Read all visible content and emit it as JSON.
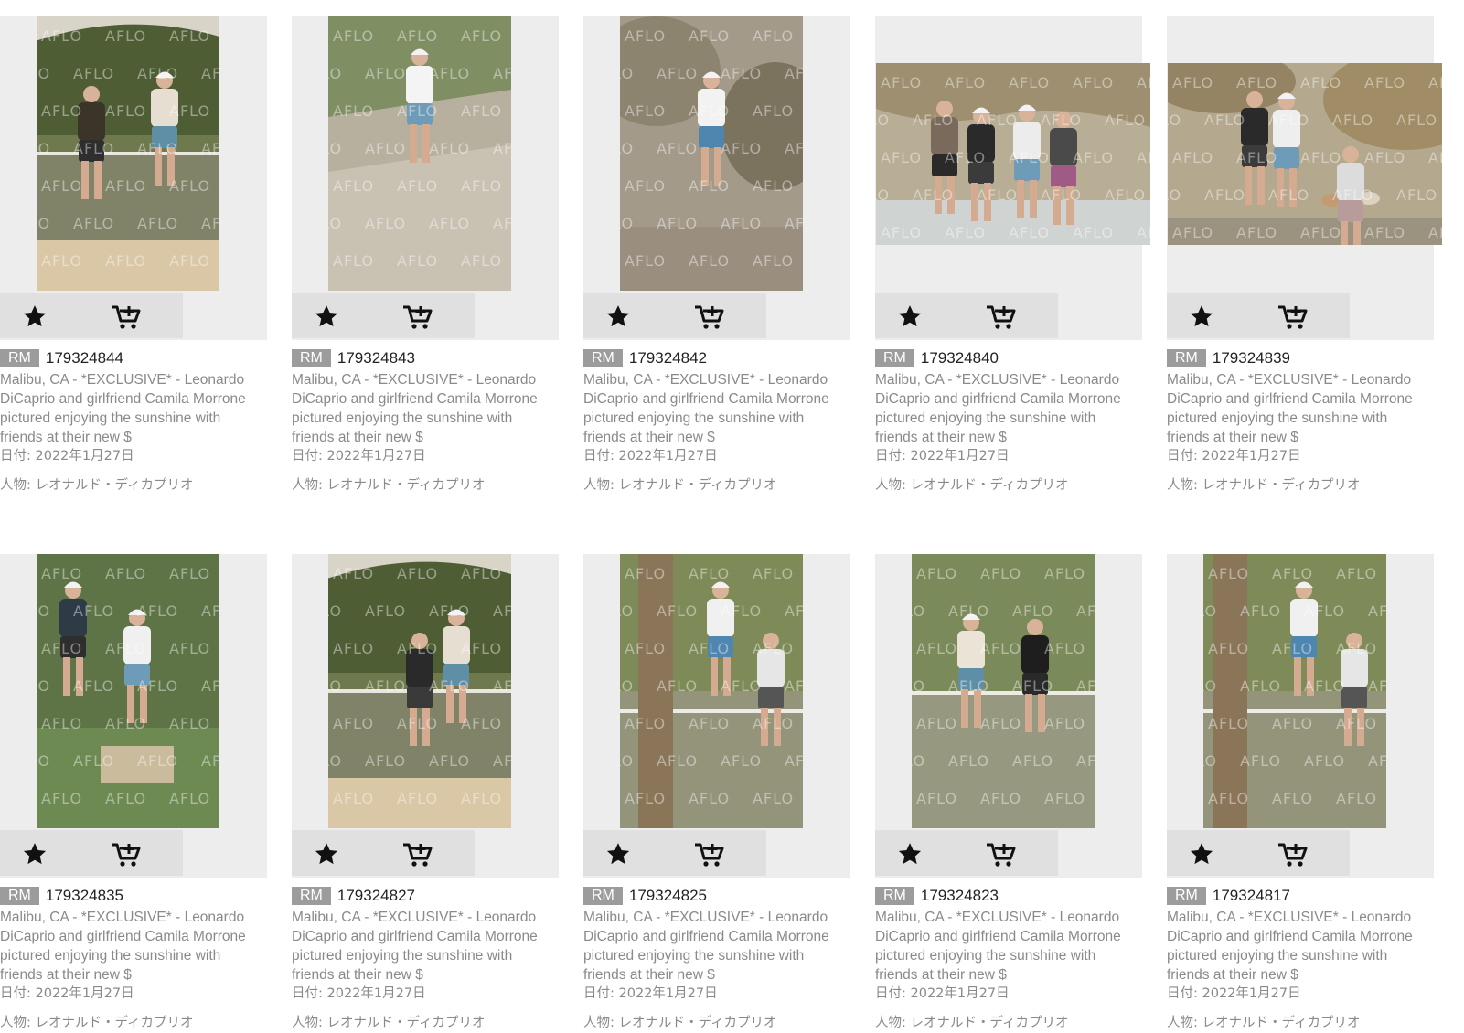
{
  "icons": {
    "favorite": "star-icon",
    "cart": "cart-add-icon"
  },
  "colors": {
    "badge": "#9c9c9c",
    "caption": "#8a8a8a",
    "thumb_bg": "#ededed",
    "action_bar": "#e0e0e0"
  },
  "watermark": "AFLO",
  "cards": [
    {
      "badge": "RM",
      "id": "179324844",
      "orientation": "portrait",
      "scene": "deck",
      "caption": "Malibu, CA - *EXCLUSIVE* - Leonardo DiCaprio and girlfriend Camila Morrone pictured enjoying the sunshine with friends at their new $",
      "date": "日付: 2022年1月27日",
      "person": "人物: レオナルド・ディカプリオ"
    },
    {
      "badge": "RM",
      "id": "179324843",
      "orientation": "portrait",
      "scene": "beach",
      "caption": "Malibu, CA - *EXCLUSIVE* - Leonardo DiCaprio and girlfriend Camila Morrone pictured enjoying the sunshine with friends at their new $",
      "date": "日付: 2022年1月27日",
      "person": "人物: レオナルド・ディカプリオ"
    },
    {
      "badge": "RM",
      "id": "179324842",
      "orientation": "portrait",
      "scene": "rocks",
      "caption": "Malibu, CA - *EXCLUSIVE* - Leonardo DiCaprio and girlfriend Camila Morrone pictured enjoying the sunshine with friends at their new $",
      "date": "日付: 2022年1月27日",
      "person": "人物: レオナルド・ディカプリオ"
    },
    {
      "badge": "RM",
      "id": "179324840",
      "orientation": "landscape",
      "scene": "group",
      "caption": "Malibu, CA - *EXCLUSIVE* - Leonardo DiCaprio and girlfriend Camila Morrone pictured enjoying the sunshine with friends at their new $",
      "date": "日付: 2022年1月27日",
      "person": "人物: レオナルド・ディカプリオ"
    },
    {
      "badge": "RM",
      "id": "179324839",
      "orientation": "landscape",
      "scene": "dogs",
      "caption": "Malibu, CA - *EXCLUSIVE* - Leonardo DiCaprio and girlfriend Camila Morrone pictured enjoying the sunshine with friends at their new $",
      "date": "日付: 2022年1月27日",
      "person": "人物: レオナルド・ディカプリオ"
    },
    {
      "badge": "RM",
      "id": "179324835",
      "orientation": "portrait",
      "scene": "hedge",
      "caption": "Malibu, CA - *EXCLUSIVE* - Leonardo DiCaprio and girlfriend Camila Morrone pictured enjoying the sunshine with friends at their new $",
      "date": "日付: 2022年1月27日",
      "person": "人物: レオナルド・ディカプリオ"
    },
    {
      "badge": "RM",
      "id": "179324827",
      "orientation": "portrait",
      "scene": "deck2",
      "caption": "Malibu, CA - *EXCLUSIVE* - Leonardo DiCaprio and girlfriend Camila Morrone pictured enjoying the sunshine with friends at their new $",
      "date": "日付: 2022年1月27日",
      "person": "人物: レオナルド・ディカプリオ"
    },
    {
      "badge": "RM",
      "id": "179324825",
      "orientation": "portrait",
      "scene": "palm",
      "caption": "Malibu, CA - *EXCLUSIVE* - Leonardo DiCaprio and girlfriend Camila Morrone pictured enjoying the sunshine with friends at their new $",
      "date": "日付: 2022年1月27日",
      "person": "人物: レオナルド・ディカプリオ"
    },
    {
      "badge": "RM",
      "id": "179324823",
      "orientation": "portrait",
      "scene": "couple",
      "caption": "Malibu, CA - *EXCLUSIVE* - Leonardo DiCaprio and girlfriend Camila Morrone pictured enjoying the sunshine with friends at their new $",
      "date": "日付: 2022年1月27日",
      "person": "人物: レオナルド・ディカプリオ"
    },
    {
      "badge": "RM",
      "id": "179324817",
      "orientation": "portrait",
      "scene": "palm2",
      "caption": "Malibu, CA - *EXCLUSIVE* - Leonardo DiCaprio and girlfriend Camila Morrone pictured enjoying the sunshine with friends at their new $",
      "date": "日付: 2022年1月27日",
      "person": "人物: レオナルド・ディカプリオ"
    }
  ]
}
